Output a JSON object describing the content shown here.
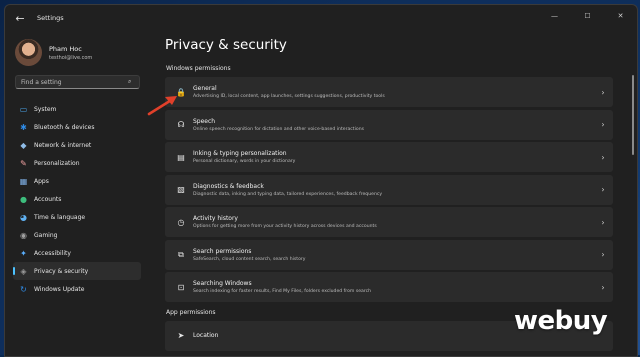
{
  "window": {
    "app_title": "Settings",
    "controls": [
      "—",
      "☐",
      "✕"
    ]
  },
  "profile": {
    "name": "Pham Hoc",
    "email": "testhoi@live.com"
  },
  "search": {
    "placeholder": "Find a setting"
  },
  "sidebar": {
    "items": [
      {
        "label": "System",
        "icon": "monitor-icon",
        "glyph": "▭",
        "color": "#4aa3e8",
        "active": false
      },
      {
        "label": "Bluetooth & devices",
        "icon": "bluetooth-icon",
        "glyph": "✱",
        "color": "#2f8be6",
        "active": false
      },
      {
        "label": "Network & internet",
        "icon": "wifi-icon",
        "glyph": "◆",
        "color": "#8fbce6",
        "active": false
      },
      {
        "label": "Personalization",
        "icon": "brush-icon",
        "glyph": "✎",
        "color": "#f0a0a0",
        "active": false
      },
      {
        "label": "Apps",
        "icon": "apps-icon",
        "glyph": "▦",
        "color": "#7fb0e6",
        "active": false
      },
      {
        "label": "Accounts",
        "icon": "person-icon",
        "glyph": "●",
        "color": "#3dbd7d",
        "active": false
      },
      {
        "label": "Time & language",
        "icon": "globe-clock-icon",
        "glyph": "◕",
        "color": "#5fb0f0",
        "active": false
      },
      {
        "label": "Gaming",
        "icon": "controller-icon",
        "glyph": "◉",
        "color": "#a0a0a0",
        "active": false
      },
      {
        "label": "Accessibility",
        "icon": "accessibility-icon",
        "glyph": "✦",
        "color": "#5ab0ff",
        "active": false
      },
      {
        "label": "Privacy & security",
        "icon": "shield-icon",
        "glyph": "◈",
        "color": "#9a9a9a",
        "active": true
      },
      {
        "label": "Windows Update",
        "icon": "update-icon",
        "glyph": "↻",
        "color": "#2f8be6",
        "active": false
      }
    ]
  },
  "main": {
    "title": "Privacy & security",
    "sections": [
      {
        "title": "Windows permissions",
        "cards": [
          {
            "title": "General",
            "desc": "Advertising ID, local content, app launches, settings suggestions, productivity tools",
            "icon": "lock-icon",
            "glyph": "🔒"
          },
          {
            "title": "Speech",
            "desc": "Online speech recognition for dictation and other voice-based interactions",
            "icon": "speech-icon",
            "glyph": "☊"
          },
          {
            "title": "Inking & typing personalization",
            "desc": "Personal dictionary, words in your dictionary",
            "icon": "notebook-icon",
            "glyph": "▤"
          },
          {
            "title": "Diagnostics & feedback",
            "desc": "Diagnostic data, inking and typing data, tailored experiences, feedback frequency",
            "icon": "chart-icon",
            "glyph": "▧"
          },
          {
            "title": "Activity history",
            "desc": "Options for getting more from your activity history across devices and accounts",
            "icon": "history-icon",
            "glyph": "◷"
          },
          {
            "title": "Search permissions",
            "desc": "SafeSearch, cloud content search, search history",
            "icon": "search-window-icon",
            "glyph": "⧉"
          },
          {
            "title": "Searching Windows",
            "desc": "Search indexing for faster results, Find My Files, folders excluded from search",
            "icon": "search-folder-icon",
            "glyph": "⊡"
          }
        ]
      },
      {
        "title": "App permissions",
        "cards": [
          {
            "title": "Location",
            "desc": "",
            "icon": "location-icon",
            "glyph": "➤"
          }
        ]
      }
    ]
  },
  "watermark": {
    "text": "webuy"
  },
  "colors": {
    "accent": "#4cc2ff",
    "arrow": "#e0402a",
    "card_bg": "#2b2b2b",
    "window_bg": "#202020"
  }
}
